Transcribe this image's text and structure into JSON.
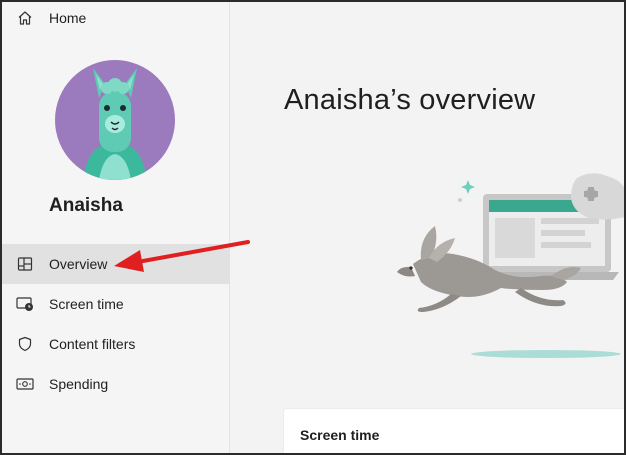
{
  "sidebar": {
    "home_label": "Home",
    "profile_name": "Anaisha",
    "items": [
      {
        "label": "Overview",
        "icon": "overview-icon",
        "active": true
      },
      {
        "label": "Screen time",
        "icon": "screen-time-icon",
        "active": false
      },
      {
        "label": "Content filters",
        "icon": "shield-icon",
        "active": false
      },
      {
        "label": "Spending",
        "icon": "spending-icon",
        "active": false
      }
    ]
  },
  "main": {
    "title": "Anaisha’s overview",
    "card_title": "Screen time"
  },
  "colors": {
    "accent_arrow": "#e02020",
    "avatar_bg": "#9b7bbd",
    "llama": "#5fcbb4",
    "active_bg": "#e1e1e1"
  }
}
